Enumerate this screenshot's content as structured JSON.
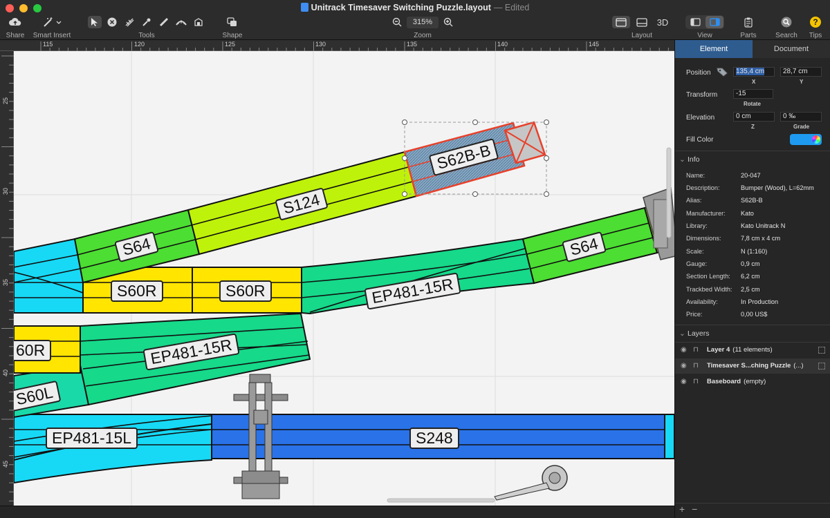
{
  "window": {
    "title": "Unitrack Timesaver Switching Puzzle.layout",
    "status": "Edited",
    "colors": {
      "close": "#ff5f57",
      "minimize": "#febc2e",
      "zoom": "#28c840"
    }
  },
  "toolbar": {
    "share": "Share",
    "smart_insert": "Smart Insert",
    "tools": "Tools",
    "shape": "Shape",
    "zoom_value": "315%",
    "zoom": "Zoom",
    "layout": "Layout",
    "layout_3d": "3D",
    "view": "View",
    "parts": "Parts",
    "search": "Search",
    "tips": "Tips",
    "tips_glyph": "?"
  },
  "rulers": {
    "horizontal": [
      "115",
      "120",
      "125",
      "130",
      "135",
      "140",
      "145"
    ],
    "vertical": [
      "25",
      "30",
      "35",
      "40",
      "45"
    ]
  },
  "tracks": {
    "s62b_b": "S62B-B",
    "s124": "S124",
    "s64_top": "S64",
    "s64_right": "S64",
    "s60r_1": "S60R",
    "s60r_2": "S60R",
    "s60r_left": "60R",
    "ep481_15r_top": "EP481-15R",
    "ep481_15r_mid": "EP481-15R",
    "s60l": "S60L",
    "ep481_15l": "EP481-15L",
    "s248": "S248",
    "colors": {
      "lime": "#bff20a",
      "green": "#4cde32",
      "teal": "#16d98a",
      "cyan": "#17d9f5",
      "yellow": "#ffe500",
      "blue": "#2a72e8",
      "selection": "#e8402a"
    }
  },
  "inspector": {
    "tab_element": "Element",
    "tab_document": "Document",
    "position_label": "Position",
    "position_x": "135,4 cm",
    "position_y": "28,7 cm",
    "x": "X",
    "y": "Y",
    "transform_label": "Transform",
    "rotate_value": "-15",
    "rotate": "Rotate",
    "elevation_label": "Elevation",
    "elevation_z": "0 cm",
    "grade_value": "0 ‰",
    "z": "Z",
    "grade": "Grade",
    "fill_color": "Fill Color",
    "fill_hex": "#1e9bf0",
    "info_title": "Info",
    "info": [
      {
        "k": "Name:",
        "v": "20-047"
      },
      {
        "k": "Description:",
        "v": "Bumper (Wood), L=62mm"
      },
      {
        "k": "Alias:",
        "v": "S62B-B"
      },
      {
        "k": "Manufacturer:",
        "v": "Kato"
      },
      {
        "k": "Library:",
        "v": "Kato Unitrack N"
      },
      {
        "k": "Dimensions:",
        "v": "7,8 cm x 4 cm"
      },
      {
        "k": "Scale:",
        "v": "N (1:160)"
      },
      {
        "k": "Gauge:",
        "v": "0,9 cm"
      },
      {
        "k": "Section Length:",
        "v": "6,2 cm"
      },
      {
        "k": "Trackbed Width:",
        "v": "2,5 cm"
      },
      {
        "k": "Availability:",
        "v": "In Production"
      },
      {
        "k": "Price:",
        "v": "0,00 US$"
      }
    ],
    "layers_title": "Layers",
    "layers": [
      {
        "name": "Layer 4",
        "meta": "(11 elements)"
      },
      {
        "name": "Timesaver S...ching Puzzle",
        "meta": "(...)"
      },
      {
        "name": "Baseboard",
        "meta": "(empty)"
      }
    ],
    "footer_add": "+",
    "footer_remove": "−"
  }
}
